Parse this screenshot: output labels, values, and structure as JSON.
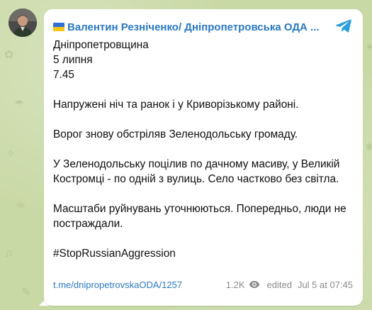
{
  "channel": {
    "name": "Валентин Резніченко/ Дніпропетровська ОДА ..."
  },
  "message": {
    "lines": [
      "Дніпропетровщина",
      "5 липня",
      "7.45",
      "Напружені ніч та ранок і у Криворізькому районі.",
      "Ворог знову обстріляв Зеленодольську громаду.",
      "У Зеленодольську поцілив по дачному масиву, у Великій Костромці - по одній з вулиць. Село частково без світла.",
      "Масштаби руйнувань уточнюються. Попередньо, люди не постраждали.",
      "#StopRussianAggression"
    ]
  },
  "footer": {
    "link": "t.me/dnipropetrovskaODA/1257",
    "views": "1.2K",
    "edited_label": "edited",
    "timestamp": "Jul 5 at 07:45"
  },
  "colors": {
    "accent": "#2a78c2",
    "bubble": "#ffffff",
    "background": "#c9d9a6",
    "meta": "#8a8a8a"
  },
  "icons": {
    "avatar": "avatar-photo",
    "flag": "ukraine-flag-icon",
    "share": "telegram-share-icon",
    "views": "eye-icon"
  }
}
